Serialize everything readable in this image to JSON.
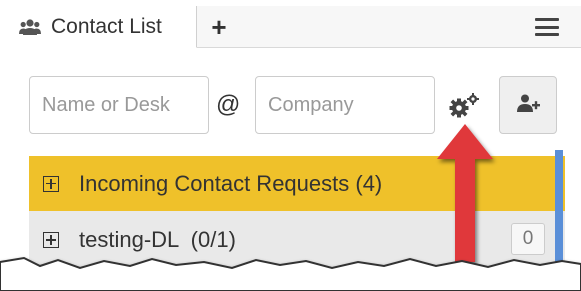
{
  "tabs": {
    "active_label": "Contact List",
    "active_icon": "users-icon",
    "add_label": "+",
    "menu_icon": "hamburger-menu-icon"
  },
  "search": {
    "name_placeholder": "Name or Desk",
    "name_value": "",
    "at_label": "@",
    "company_placeholder": "Company",
    "company_value": "",
    "settings_icon": "gears-icon",
    "add_contact_icon": "add-user-icon"
  },
  "list": {
    "requests_label": "Incoming Contact Requests (4)",
    "group_label": "testing-DL  (0/1)",
    "group_count": "0"
  },
  "colors": {
    "requests_row": "#efc12a",
    "group_row": "#e9e9e9",
    "arrow": "#e0383b",
    "scroll_strip": "#5a8fd8"
  }
}
